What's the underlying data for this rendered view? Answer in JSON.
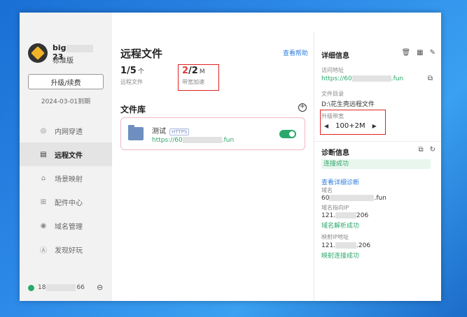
{
  "window": {
    "controls": [
      "▦",
      "≡",
      "✕"
    ]
  },
  "sidebar": {
    "username_start": "big",
    "username_end": "23",
    "plan": "标准版",
    "upgrade_label": "升级/续费",
    "expire": "2024-03-01到期",
    "items": [
      {
        "label": "内网穿透",
        "icon": "globe-icon",
        "glyph": "◎"
      },
      {
        "label": "远程文件",
        "icon": "folder-icon",
        "glyph": "▤"
      },
      {
        "label": "场景映射",
        "icon": "house-icon",
        "glyph": "⌂"
      },
      {
        "label": "配件中心",
        "icon": "grid-icon",
        "glyph": "⊞"
      },
      {
        "label": "域名管理",
        "icon": "domain-icon",
        "glyph": "◉"
      },
      {
        "label": "发现好玩",
        "icon": "compass-icon",
        "glyph": "Ⓐ"
      }
    ],
    "phone_start": "18",
    "phone_end": "66"
  },
  "main": {
    "title": "远程文件",
    "help_link": "查看帮助",
    "stat_files": {
      "value": "1/5",
      "unit": "个",
      "label": "远程文件"
    },
    "stat_bandwidth": {
      "used": "2",
      "total": "/2",
      "unit": "M",
      "label": "带宽加速"
    },
    "library_title": "文件库",
    "card": {
      "name": "测试",
      "tag": "HTTPS",
      "url_start": "https://60",
      "url_end": ".fun",
      "enabled": true
    }
  },
  "details": {
    "title": "详细信息",
    "access_label": "访问地址",
    "access_start": "https://60",
    "access_end": ".fun",
    "dir_label": "文件目录",
    "dir_value": "D:\\花生壳远程文件",
    "bw_label": "升级带宽",
    "bw_value": "100+2M"
  },
  "diagnosis": {
    "title": "诊断信息",
    "status": "连接成功",
    "detail_link": "查看详细诊断",
    "domain_label": "域名",
    "domain_start": "60",
    "domain_end": ".fun",
    "domain_ip_label": "域名指向IP",
    "domain_ip_start": "121.",
    "domain_ip_end": "206",
    "domain_ok": "域名解析成功",
    "map_ip_label": "映射IP地址",
    "map_ip_start": "121.",
    "map_ip_end": ".206",
    "map_ok": "映射连接成功"
  },
  "colors": {
    "accent": "#2aa86b",
    "link": "#2f7de1",
    "alert": "#e23b3b"
  }
}
